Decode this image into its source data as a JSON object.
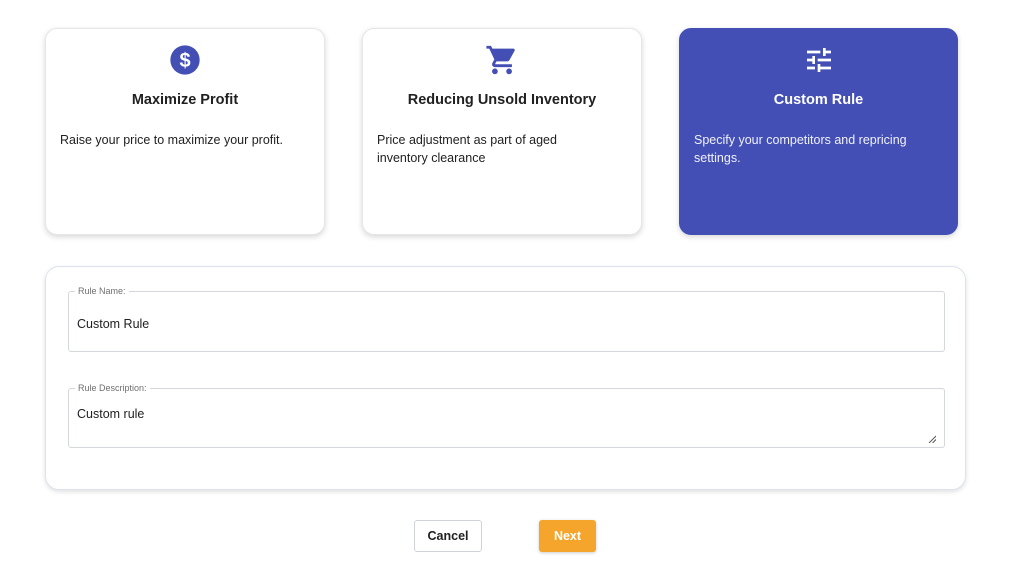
{
  "theme": {
    "accent": "#434fb5",
    "next_button": "#f5a52c"
  },
  "strategy_cards": [
    {
      "icon": "dollar-circle-icon",
      "title": "Maximize Profit",
      "description": "Raise your price to maximize your profit.",
      "selected": false
    },
    {
      "icon": "shopping-cart-icon",
      "title": "Reducing Unsold Inventory",
      "description": "Price adjustment as part of aged inventory clearance",
      "selected": false
    },
    {
      "icon": "sliders-icon",
      "title": "Custom Rule",
      "description": "Specify your competitors and repricing settings.",
      "selected": true
    }
  ],
  "form": {
    "rule_name": {
      "label": "Rule Name:",
      "value": "Custom Rule"
    },
    "rule_description": {
      "label": "Rule Description:",
      "value": "Custom rule"
    }
  },
  "actions": {
    "cancel_label": "Cancel",
    "next_label": "Next"
  }
}
